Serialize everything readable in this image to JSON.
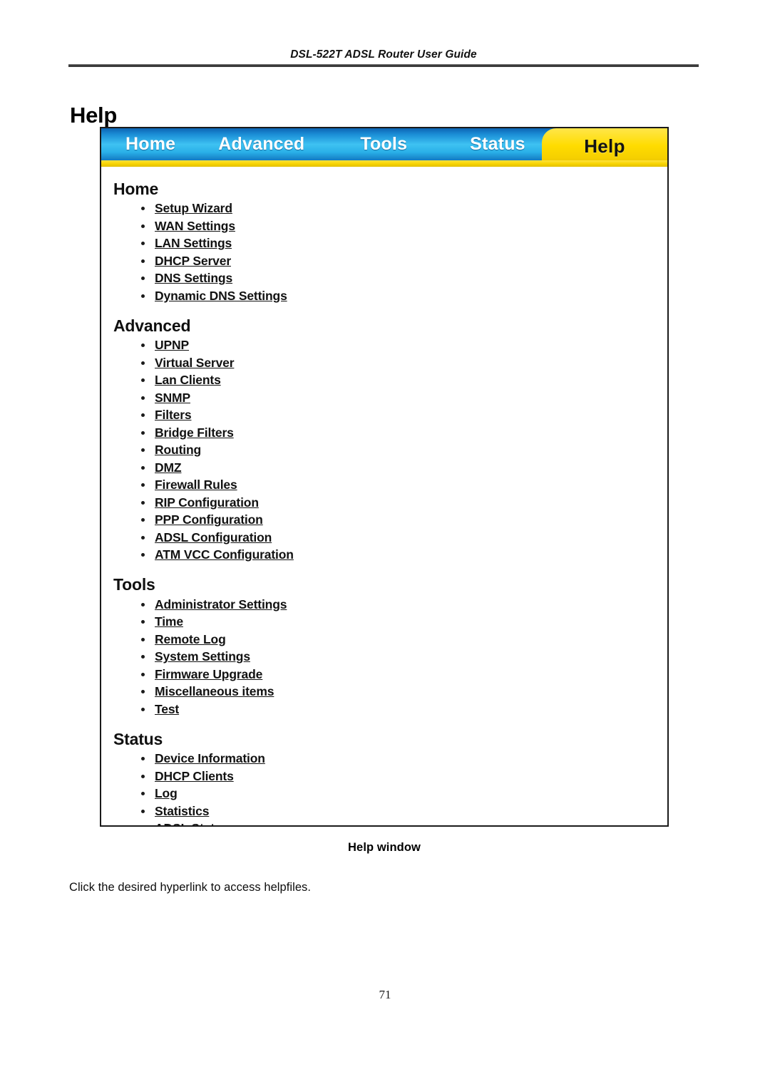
{
  "document": {
    "running_header": "DSL-522T ADSL Router User Guide",
    "page_title": "Help",
    "figure_caption": "Help window",
    "body_paragraph": "Click the desired hyperlink to access helpfiles.",
    "page_number": "71"
  },
  "router_ui": {
    "nav": {
      "tabs": [
        {
          "label": "Home",
          "active": false
        },
        {
          "label": "Advanced",
          "active": false
        },
        {
          "label": "Tools",
          "active": false
        },
        {
          "label": "Status",
          "active": false
        }
      ],
      "active_tab": {
        "label": "Help",
        "active": true
      },
      "colors": {
        "tab_blue": "#1b8ed6",
        "tab_blue_light": "#3ec2f2",
        "tab_blue_dark": "#0a5ea6",
        "active_yellow": "#ffdc00",
        "yellow_strip": "#f7d400",
        "tab_text": "#ffffff",
        "active_tab_text": "#141414"
      }
    },
    "sections": [
      {
        "heading": "Home",
        "links": [
          "Setup Wizard",
          "WAN Settings",
          "LAN Settings",
          "DHCP Server",
          "DNS Settings",
          "Dynamic DNS Settings"
        ]
      },
      {
        "heading": "Advanced",
        "links": [
          "UPNP",
          "Virtual Server",
          "Lan Clients",
          "SNMP",
          "Filters",
          "Bridge Filters",
          "Routing",
          "DMZ",
          "Firewall Rules",
          "RIP Configuration",
          "PPP Configuration",
          "ADSL Configuration",
          "ATM VCC Configuration"
        ]
      },
      {
        "heading": "Tools",
        "links": [
          "Administrator Settings",
          "Time",
          "Remote Log",
          "System Settings",
          "Firmware Upgrade",
          "Miscellaneous items",
          "Test"
        ]
      },
      {
        "heading": "Status",
        "links": [
          "Device Information",
          "DHCP Clients",
          "Log",
          "Statistics",
          "ADSL Status"
        ]
      }
    ]
  }
}
